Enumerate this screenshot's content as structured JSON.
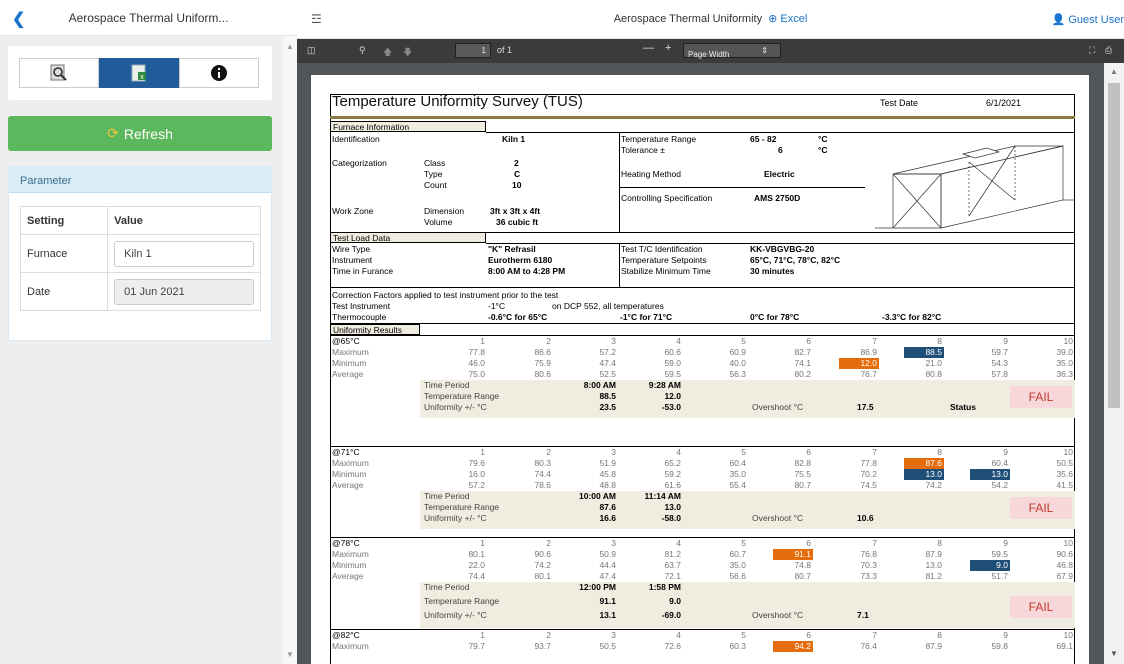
{
  "left": {
    "header_title": "Aerospace Thermal Uniform...",
    "refresh_label": "Refresh",
    "param_title": "Parameter",
    "col_setting": "Setting",
    "col_value": "Value",
    "rows": [
      {
        "label": "Furnace",
        "value": "Kiln 1"
      },
      {
        "label": "Date",
        "value": "01 Jun 2021"
      }
    ]
  },
  "right": {
    "title": "Aerospace Thermal Uniformity",
    "excel_link": "Excel",
    "user": "Guest User",
    "page_input": "1",
    "page_of": "of 1",
    "zoom": "Page Width"
  },
  "sheet": {
    "title": "Temperature Uniformity Survey (TUS)",
    "test_date_label": "Test Date",
    "test_date": "6/1/2021",
    "furnace_info": "Furnace Information",
    "identification_label": "Identification",
    "identification": "Kiln 1",
    "categorization_label": "Categorization",
    "class_label": "Class",
    "class": "2",
    "type_label": "Type",
    "type": "C",
    "count_label": "Count",
    "count": "10",
    "work_zone_label": "Work Zone",
    "dimension_label": "Dimension",
    "dimension": "3ft x 3ft x 4ft",
    "volume_label": "Volume",
    "volume": "36 cubic ft",
    "temp_range_label": "Temperature Range",
    "temp_range": "65 - 82",
    "temp_unit": "°C",
    "tolerance_label": "Tolerance ±",
    "tolerance": "6",
    "tol_unit": "°C",
    "heating_label": "Heating Method",
    "heating": "Electric",
    "spec_label": "Controlling Specification",
    "spec": "AMS 2750D",
    "test_load": "Test Load Data",
    "wire_label": "Wire Type",
    "wire": "\"K\" Refrasil",
    "instrument_label": "Instrument",
    "instrument": "Eurotherm 6180",
    "time_label": "Time in Furance",
    "time": "8:00 AM to 4:28 PM",
    "tc_label": "Test T/C Identification",
    "tc": "KK-VBGVBG-20",
    "setpoints_label": "Temperature Setpoints",
    "setpoints": "65°C, 71°C, 78°C, 82°C",
    "stabilize_label": "Stabilize Minimum Time",
    "stabilize": "30 minutes",
    "correction_title": "Correction Factors applied to test instrument prior to the test",
    "ti_label": "Test Instrument",
    "ti_val": "-1°C",
    "ti_note": "on DCP 552, all temperatures",
    "thermo_label": "Thermocouple",
    "thermo": [
      "-0.6°C for 65°C",
      "-1°C for 71°C",
      "0°C for 78°C",
      "-3.3°C for 82°C"
    ],
    "uniformity_results": "Uniformity Results",
    "row_labels": [
      "Maximum",
      "Minimum",
      "Average"
    ],
    "cols": [
      "1",
      "2",
      "3",
      "4",
      "5",
      "6",
      "7",
      "8",
      "9",
      "10"
    ],
    "sum_labels": [
      "Time Period",
      "Temperature Range",
      "Uniformity +/- °C"
    ],
    "overshoot_label": "Overshoot °C",
    "status_label": "Status",
    "sections": [
      {
        "setpoint": "@65°C",
        "max": [
          "77.8",
          "86.6",
          "57.2",
          "60.6",
          "60.9",
          "82.7",
          "86.9",
          "88.5",
          "59.7",
          "39.0"
        ],
        "min": [
          "46.0",
          "75.9",
          "47.4",
          "59.0",
          "40.0",
          "74.1",
          "12.0",
          "21.0",
          "54.3",
          "35.0"
        ],
        "avg": [
          "75.0",
          "80.6",
          "52.5",
          "59.5",
          "56.3",
          "80.2",
          "76.7",
          "80.8",
          "57.8",
          "36.3"
        ],
        "time": [
          "8:00 AM",
          "9:28 AM"
        ],
        "range": [
          "88.5",
          "12.0"
        ],
        "unif": [
          "23.5",
          "-53.0"
        ],
        "overshoot": "17.5",
        "status": "FAIL"
      },
      {
        "setpoint": "@71°C",
        "max": [
          "79.6",
          "80.3",
          "51.9",
          "65.2",
          "60.4",
          "82.8",
          "77.8",
          "87.6",
          "60.4",
          "50.5"
        ],
        "min": [
          "16.0",
          "74.4",
          "45.8",
          "59.2",
          "35.0",
          "75.5",
          "70.2",
          "13.0",
          "13.0",
          "35.6"
        ],
        "avg": [
          "57.2",
          "78.6",
          "48.8",
          "61.6",
          "55.4",
          "80.7",
          "74.5",
          "74.2",
          "54.2",
          "41.5"
        ],
        "time": [
          "10:00 AM",
          "11:14 AM"
        ],
        "range": [
          "87.6",
          "13.0"
        ],
        "unif": [
          "16.6",
          "-58.0"
        ],
        "overshoot": "10.6",
        "status": "FAIL"
      },
      {
        "setpoint": "@78°C",
        "max": [
          "80.1",
          "90.6",
          "50.9",
          "81.2",
          "60.7",
          "91.1",
          "76.8",
          "87.9",
          "59.5",
          "90.6"
        ],
        "min": [
          "22.0",
          "74.2",
          "44.4",
          "63.7",
          "35.0",
          "74.8",
          "70.3",
          "13.0",
          "9.0",
          "46.8"
        ],
        "avg": [
          "74.4",
          "80.1",
          "47.4",
          "72.1",
          "56.6",
          "80.7",
          "73.3",
          "81.2",
          "51.7",
          "67.9"
        ],
        "time": [
          "12:00 PM",
          "1:58 PM"
        ],
        "range": [
          "91.1",
          "9.0"
        ],
        "unif": [
          "13.1",
          "-69.0"
        ],
        "overshoot": "7.1",
        "status": "FAIL"
      },
      {
        "setpoint": "@82°C",
        "max": [
          "79.7",
          "93.7",
          "50.5",
          "72.6",
          "60.3",
          "94.2",
          "76.4",
          "87.9",
          "59.8",
          "69.1"
        ]
      }
    ],
    "highlights": [
      {
        "section": 0,
        "row": "max",
        "col": 7,
        "color": "blue"
      },
      {
        "section": 0,
        "row": "min",
        "col": 6,
        "color": "orange"
      },
      {
        "section": 1,
        "row": "max",
        "col": 7,
        "color": "orange"
      },
      {
        "section": 1,
        "row": "min",
        "col": 7,
        "color": "blue"
      },
      {
        "section": 1,
        "row": "min",
        "col": 8,
        "color": "blue"
      },
      {
        "section": 2,
        "row": "max",
        "col": 5,
        "color": "orange"
      },
      {
        "section": 2,
        "row": "min",
        "col": 8,
        "color": "blue"
      },
      {
        "section": 3,
        "row": "max",
        "col": 5,
        "color": "orange"
      }
    ],
    "colors": {
      "blue": "#1f4e79",
      "orange": "#e46c0a",
      "fail_bg": "#f8d7da",
      "fail_text": "#c0392b",
      "refresh": "#5cb85c"
    }
  }
}
